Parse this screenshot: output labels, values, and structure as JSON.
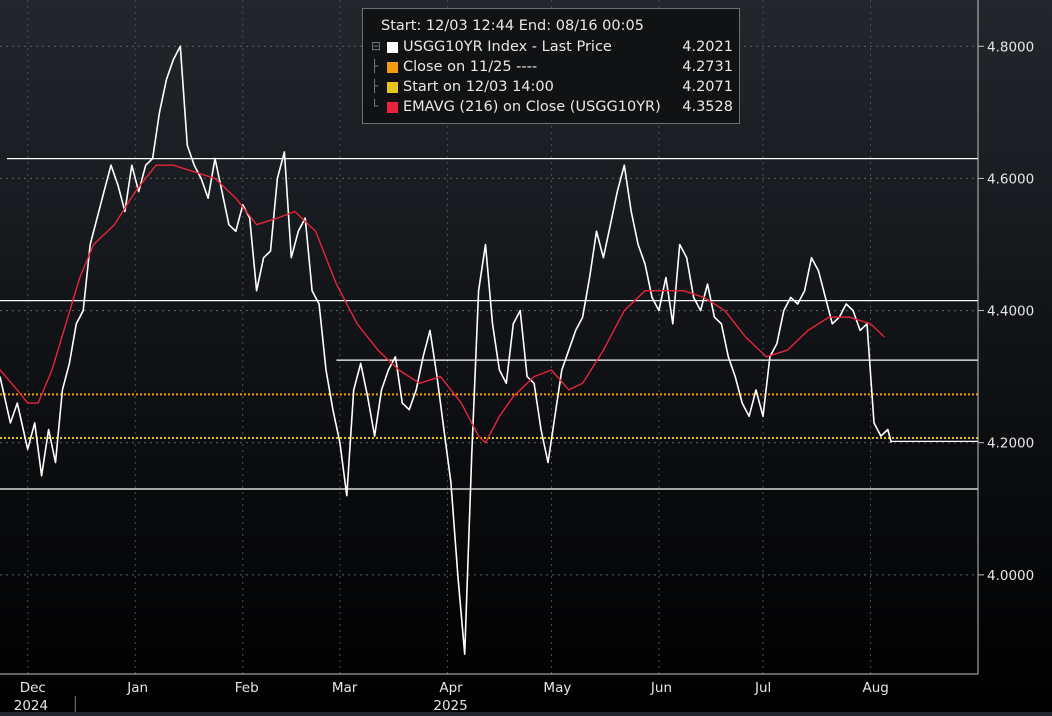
{
  "legend": {
    "header": "Start: 12/03 12:44 End: 08/16 00:05",
    "items": [
      {
        "label": "USGG10YR Index - Last Price",
        "value": "4.2021",
        "color": "#ffffff"
      },
      {
        "label": "Close on 11/25 ----",
        "value": "4.2731",
        "color": "#f39c12"
      },
      {
        "label": "Start on 12/03 14:00",
        "value": "4.2071",
        "color": "#e6c619"
      },
      {
        "label": "EMAVG (216)  on Close (USGG10YR)",
        "value": "4.3528",
        "color": "#e8243c"
      }
    ]
  },
  "chart_data": {
    "type": "line",
    "title": "",
    "ylim": [
      3.85,
      4.87
    ],
    "xlim": [
      "2024-11-23",
      "2025-09-01"
    ],
    "y_ticks": [
      "4.8000",
      "4.6000",
      "4.4000",
      "4.2000",
      "4.0000"
    ],
    "x_ticks": [
      {
        "label": "Dec",
        "date": "2024-12-01"
      },
      {
        "label": "Jan",
        "date": "2025-01-01"
      },
      {
        "label": "Feb",
        "date": "2025-02-01"
      },
      {
        "label": "Mar",
        "date": "2025-03-01"
      },
      {
        "label": "Apr",
        "date": "2025-04-01"
      },
      {
        "label": "May",
        "date": "2025-05-01"
      },
      {
        "label": "Jun",
        "date": "2025-06-01"
      },
      {
        "label": "Jul",
        "date": "2025-07-01"
      },
      {
        "label": "Aug",
        "date": "2025-08-01"
      }
    ],
    "year_labels": [
      {
        "label": "2024",
        "date": "2024-12-01"
      },
      {
        "label": "2025",
        "date": "2025-04-01"
      }
    ],
    "grid": true,
    "legend_position": "top-center",
    "series": [
      {
        "name": "USGG10YR Index - Last Price",
        "color": "#ffffff",
        "points": [
          [
            "2024-11-23",
            4.3
          ],
          [
            "2024-11-26",
            4.23
          ],
          [
            "2024-11-28",
            4.26
          ],
          [
            "2024-12-01",
            4.19
          ],
          [
            "2024-12-03",
            4.23
          ],
          [
            "2024-12-05",
            4.15
          ],
          [
            "2024-12-07",
            4.22
          ],
          [
            "2024-12-09",
            4.17
          ],
          [
            "2024-12-11",
            4.28
          ],
          [
            "2024-12-13",
            4.32
          ],
          [
            "2024-12-15",
            4.38
          ],
          [
            "2024-12-17",
            4.4
          ],
          [
            "2024-12-19",
            4.5
          ],
          [
            "2024-12-21",
            4.54
          ],
          [
            "2024-12-23",
            4.58
          ],
          [
            "2024-12-25",
            4.62
          ],
          [
            "2024-12-27",
            4.59
          ],
          [
            "2024-12-29",
            4.55
          ],
          [
            "2024-12-31",
            4.62
          ],
          [
            "2025-01-02",
            4.58
          ],
          [
            "2025-01-04",
            4.62
          ],
          [
            "2025-01-06",
            4.63
          ],
          [
            "2025-01-08",
            4.7
          ],
          [
            "2025-01-10",
            4.75
          ],
          [
            "2025-01-12",
            4.78
          ],
          [
            "2025-01-14",
            4.8
          ],
          [
            "2025-01-16",
            4.65
          ],
          [
            "2025-01-18",
            4.62
          ],
          [
            "2025-01-20",
            4.6
          ],
          [
            "2025-01-22",
            4.57
          ],
          [
            "2025-01-24",
            4.63
          ],
          [
            "2025-01-26",
            4.58
          ],
          [
            "2025-01-28",
            4.53
          ],
          [
            "2025-01-30",
            4.52
          ],
          [
            "2025-02-01",
            4.56
          ],
          [
            "2025-02-03",
            4.54
          ],
          [
            "2025-02-05",
            4.43
          ],
          [
            "2025-02-07",
            4.48
          ],
          [
            "2025-02-09",
            4.49
          ],
          [
            "2025-02-11",
            4.6
          ],
          [
            "2025-02-13",
            4.64
          ],
          [
            "2025-02-15",
            4.48
          ],
          [
            "2025-02-17",
            4.52
          ],
          [
            "2025-02-19",
            4.54
          ],
          [
            "2025-02-21",
            4.43
          ],
          [
            "2025-02-23",
            4.41
          ],
          [
            "2025-02-25",
            4.31
          ],
          [
            "2025-02-27",
            4.25
          ],
          [
            "2025-03-01",
            4.2
          ],
          [
            "2025-03-03",
            4.12
          ],
          [
            "2025-03-05",
            4.28
          ],
          [
            "2025-03-07",
            4.32
          ],
          [
            "2025-03-09",
            4.27
          ],
          [
            "2025-03-11",
            4.21
          ],
          [
            "2025-03-13",
            4.28
          ],
          [
            "2025-03-15",
            4.31
          ],
          [
            "2025-03-17",
            4.33
          ],
          [
            "2025-03-19",
            4.26
          ],
          [
            "2025-03-21",
            4.25
          ],
          [
            "2025-03-23",
            4.28
          ],
          [
            "2025-03-25",
            4.33
          ],
          [
            "2025-03-27",
            4.37
          ],
          [
            "2025-03-29",
            4.3
          ],
          [
            "2025-03-31",
            4.22
          ],
          [
            "2025-04-02",
            4.14
          ],
          [
            "2025-04-04",
            4.0
          ],
          [
            "2025-04-06",
            3.88
          ],
          [
            "2025-04-08",
            4.18
          ],
          [
            "2025-04-10",
            4.43
          ],
          [
            "2025-04-12",
            4.5
          ],
          [
            "2025-04-14",
            4.38
          ],
          [
            "2025-04-16",
            4.31
          ],
          [
            "2025-04-18",
            4.29
          ],
          [
            "2025-04-20",
            4.38
          ],
          [
            "2025-04-22",
            4.4
          ],
          [
            "2025-04-24",
            4.3
          ],
          [
            "2025-04-26",
            4.29
          ],
          [
            "2025-04-28",
            4.22
          ],
          [
            "2025-04-30",
            4.17
          ],
          [
            "2025-05-02",
            4.24
          ],
          [
            "2025-05-04",
            4.31
          ],
          [
            "2025-05-06",
            4.34
          ],
          [
            "2025-05-08",
            4.37
          ],
          [
            "2025-05-10",
            4.39
          ],
          [
            "2025-05-12",
            4.45
          ],
          [
            "2025-05-14",
            4.52
          ],
          [
            "2025-05-16",
            4.48
          ],
          [
            "2025-05-18",
            4.53
          ],
          [
            "2025-05-20",
            4.58
          ],
          [
            "2025-05-22",
            4.62
          ],
          [
            "2025-05-24",
            4.55
          ],
          [
            "2025-05-26",
            4.5
          ],
          [
            "2025-05-28",
            4.47
          ],
          [
            "2025-05-30",
            4.42
          ],
          [
            "2025-06-01",
            4.4
          ],
          [
            "2025-06-03",
            4.45
          ],
          [
            "2025-06-05",
            4.38
          ],
          [
            "2025-06-07",
            4.5
          ],
          [
            "2025-06-09",
            4.48
          ],
          [
            "2025-06-11",
            4.42
          ],
          [
            "2025-06-13",
            4.4
          ],
          [
            "2025-06-15",
            4.44
          ],
          [
            "2025-06-17",
            4.39
          ],
          [
            "2025-06-19",
            4.38
          ],
          [
            "2025-06-21",
            4.33
          ],
          [
            "2025-06-23",
            4.3
          ],
          [
            "2025-06-25",
            4.26
          ],
          [
            "2025-06-27",
            4.24
          ],
          [
            "2025-06-29",
            4.28
          ],
          [
            "2025-07-01",
            4.24
          ],
          [
            "2025-07-03",
            4.33
          ],
          [
            "2025-07-05",
            4.35
          ],
          [
            "2025-07-07",
            4.4
          ],
          [
            "2025-07-09",
            4.42
          ],
          [
            "2025-07-11",
            4.41
          ],
          [
            "2025-07-13",
            4.43
          ],
          [
            "2025-07-15",
            4.48
          ],
          [
            "2025-07-17",
            4.46
          ],
          [
            "2025-07-19",
            4.42
          ],
          [
            "2025-07-21",
            4.38
          ],
          [
            "2025-07-23",
            4.39
          ],
          [
            "2025-07-25",
            4.41
          ],
          [
            "2025-07-27",
            4.4
          ],
          [
            "2025-07-29",
            4.37
          ],
          [
            "2025-07-31",
            4.38
          ],
          [
            "2025-08-02",
            4.23
          ],
          [
            "2025-08-04",
            4.21
          ],
          [
            "2025-08-06",
            4.22
          ],
          [
            "2025-08-07",
            4.2
          ]
        ]
      },
      {
        "name": "EMAVG (216)  on Close (USGG10YR)",
        "color": "#e8243c",
        "points": [
          [
            "2024-11-23",
            4.31
          ],
          [
            "2024-11-28",
            4.28
          ],
          [
            "2024-12-01",
            4.26
          ],
          [
            "2024-12-04",
            4.26
          ],
          [
            "2024-12-08",
            4.31
          ],
          [
            "2024-12-12",
            4.38
          ],
          [
            "2024-12-16",
            4.45
          ],
          [
            "2024-12-20",
            4.5
          ],
          [
            "2024-12-26",
            4.53
          ],
          [
            "2025-01-01",
            4.58
          ],
          [
            "2025-01-07",
            4.62
          ],
          [
            "2025-01-12",
            4.62
          ],
          [
            "2025-01-18",
            4.61
          ],
          [
            "2025-01-24",
            4.6
          ],
          [
            "2025-01-30",
            4.57
          ],
          [
            "2025-02-05",
            4.53
          ],
          [
            "2025-02-11",
            4.54
          ],
          [
            "2025-02-16",
            4.55
          ],
          [
            "2025-02-22",
            4.52
          ],
          [
            "2025-02-28",
            4.44
          ],
          [
            "2025-03-06",
            4.38
          ],
          [
            "2025-03-12",
            4.34
          ],
          [
            "2025-03-18",
            4.31
          ],
          [
            "2025-03-24",
            4.29
          ],
          [
            "2025-03-30",
            4.3
          ],
          [
            "2025-04-05",
            4.26
          ],
          [
            "2025-04-10",
            4.21
          ],
          [
            "2025-04-12",
            4.2
          ],
          [
            "2025-04-16",
            4.24
          ],
          [
            "2025-04-20",
            4.27
          ],
          [
            "2025-04-26",
            4.3
          ],
          [
            "2025-05-01",
            4.31
          ],
          [
            "2025-05-06",
            4.28
          ],
          [
            "2025-05-10",
            4.29
          ],
          [
            "2025-05-16",
            4.34
          ],
          [
            "2025-05-22",
            4.4
          ],
          [
            "2025-05-28",
            4.43
          ],
          [
            "2025-06-02",
            4.43
          ],
          [
            "2025-06-08",
            4.43
          ],
          [
            "2025-06-14",
            4.42
          ],
          [
            "2025-06-20",
            4.4
          ],
          [
            "2025-06-26",
            4.36
          ],
          [
            "2025-07-02",
            4.33
          ],
          [
            "2025-07-08",
            4.34
          ],
          [
            "2025-07-14",
            4.37
          ],
          [
            "2025-07-20",
            4.39
          ],
          [
            "2025-07-26",
            4.39
          ],
          [
            "2025-08-01",
            4.38
          ],
          [
            "2025-08-05",
            4.36
          ]
        ]
      }
    ],
    "reference_lines": [
      {
        "value": 4.63,
        "from": "2024-11-25",
        "color": "#ffffff",
        "style": "solid"
      },
      {
        "value": 4.415,
        "from": "2024-11-23",
        "color": "#ffffff",
        "style": "solid"
      },
      {
        "value": 4.325,
        "from": "2025-02-28",
        "color": "#ffffff",
        "style": "solid"
      },
      {
        "value": 4.13,
        "from": "2024-11-23",
        "color": "#ffffff",
        "style": "solid"
      },
      {
        "value": 4.2731,
        "from": "2024-11-23",
        "color": "#f39c12",
        "style": "dotted"
      },
      {
        "value": 4.2071,
        "from": "2024-11-23",
        "color": "#e6c619",
        "style": "dotted"
      },
      {
        "value": 4.2021,
        "from": "2025-08-07",
        "color": "#ffffff",
        "style": "solid"
      }
    ]
  }
}
